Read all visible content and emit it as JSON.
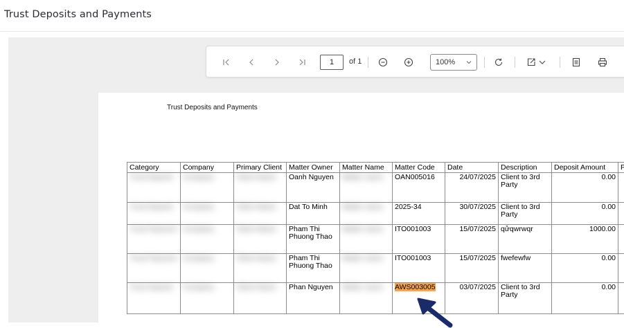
{
  "page": {
    "title": "Trust Deposits and Payments"
  },
  "toolbar": {
    "page_number": "1",
    "page_of": "of 1",
    "zoom": "100%",
    "icons": [
      "first-page-icon",
      "prev-page-icon",
      "next-page-icon",
      "last-page-icon",
      "zoom-out-icon",
      "zoom-in-icon",
      "refresh-icon",
      "export-icon",
      "print-layout-icon",
      "print-icon"
    ]
  },
  "report": {
    "title": "Trust Deposits and Payments",
    "columns": [
      "Category",
      "Company",
      "Primary Client",
      "Matter Owner",
      "Matter Name",
      "Matter Code",
      "Date",
      "Description",
      "Deposit Amount",
      "P"
    ],
    "rows": [
      {
        "category": "Trust Deposit",
        "company": "Company",
        "primary_client": "Client Name",
        "matter_owner": "Oanh Nguyen",
        "matter_name": "Matter name",
        "matter_code": "OAN005016",
        "date": "24/07/2025",
        "description": "Client to 3rd Party",
        "deposit": "0.00"
      },
      {
        "category": "Trust Deposit",
        "company": "Company",
        "primary_client": "Client Name",
        "matter_owner": "Dat To Minh",
        "matter_name": "Matter name",
        "matter_code": "2025-34",
        "date": "30/07/2025",
        "description": "Client to 3rd Party",
        "deposit": "0.00"
      },
      {
        "category": "Trust Payment",
        "company": "Company",
        "primary_client": "Client Name",
        "matter_owner": "Pham Thi Phuong Thao",
        "matter_name": "Matter name",
        "matter_code": "ITO001003",
        "date": "15/07/2025",
        "description": "qửqwrwqr",
        "deposit": "1000.00"
      },
      {
        "category": "Trust Payment",
        "company": "Company",
        "primary_client": "Client Name",
        "matter_owner": "Pham Thi Phuong Thao",
        "matter_name": "Matter name",
        "matter_code": "ITO001003",
        "date": "15/07/2025",
        "description": "fwefewfw",
        "deposit": "0.00"
      },
      {
        "category": "Trust Deposit",
        "company": "Company",
        "primary_client": "Client Name",
        "matter_owner": "Phan Nguyen",
        "matter_name": "Matter name",
        "matter_code": "AWS003005",
        "date": "03/07/2025",
        "description": "Client to 3rd Party",
        "deposit": "0.00"
      }
    ]
  },
  "colors": {
    "highlight": "#f7a44b",
    "arrow": "#1a2b6b",
    "viewer_bg": "#eeeeee"
  }
}
